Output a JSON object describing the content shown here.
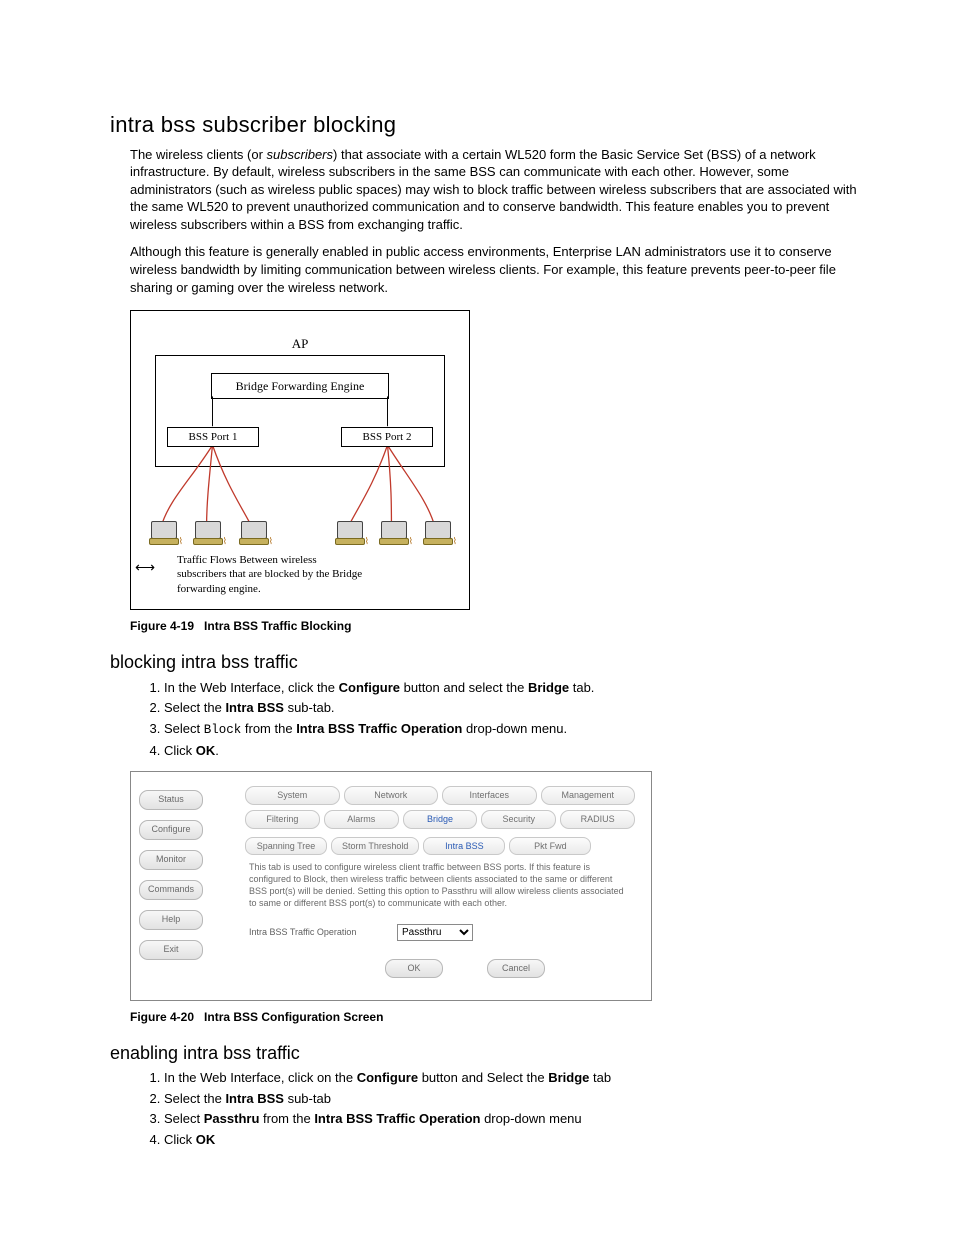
{
  "h1": "intra bss subscriber blocking",
  "p1_pre": "The wireless clients (or ",
  "p1_em": "subscribers",
  "p1_post": ") that associate with a certain WL520 form the Basic Service Set (BSS) of a network infrastructure. By default, wireless subscribers in the same BSS can communicate with each other. However, some administrators (such as wireless public spaces) may wish to block traffic between wireless subscribers that are associated with the same WL520 to prevent unauthorized communication and to conserve bandwidth. This feature enables you to prevent wireless subscribers within a BSS from exchanging traffic.",
  "p2": "Although this feature is generally enabled in public access environments, Enterprise LAN administrators use it to conserve wireless bandwidth by limiting communication between wireless clients. For example, this feature prevents peer-to-peer file sharing or gaming over the wireless network.",
  "fig19": {
    "ap": "AP",
    "bfe": "Bridge Forwarding Engine",
    "bss1": "BSS Port 1",
    "bss2": "BSS Port 2",
    "caption_text": "Traffic Flows Between wireless subscribers that are blocked by the Bridge forwarding engine.",
    "label_prefix": "Figure 4-19",
    "label_title": "Intra BSS Traffic Blocking"
  },
  "h2a": "blocking intra bss traffic",
  "steps_a": {
    "s1a": "In the Web Interface, click the ",
    "s1b": "Configure",
    "s1c": " button and select the ",
    "s1d": "Bridge",
    "s1e": " tab.",
    "s2a": "Select the ",
    "s2b": "Intra BSS",
    "s2c": " sub-tab.",
    "s3a": "Select ",
    "s3mono": "Block",
    "s3b": " from the ",
    "s3c": "Intra BSS Traffic Operation",
    "s3d": " drop-down menu.",
    "s4a": "Click ",
    "s4b": "OK",
    "s4c": "."
  },
  "fig20": {
    "side": [
      "Status",
      "Configure",
      "Monitor",
      "Commands",
      "Help",
      "Exit"
    ],
    "tabs1": [
      "System",
      "Network",
      "Interfaces",
      "Management"
    ],
    "tabs2": [
      "Filtering",
      "Alarms",
      "Bridge",
      "Security",
      "RADIUS"
    ],
    "tabs3": [
      "Spanning Tree",
      "Storm Threshold",
      "Intra BSS",
      "Pkt Fwd"
    ],
    "desc": "This tab is used to configure wireless client traffic between BSS ports. If this feature is configured to Block, then wireless traffic between clients associated to the same or different BSS port(s) will be denied. Setting this option to Passthru will allow wireless clients associated to same or different BSS port(s) to communicate with each other.",
    "field_label": "Intra BSS Traffic Operation",
    "field_value": "Passthru",
    "ok": "OK",
    "cancel": "Cancel",
    "label_prefix": "Figure 4-20",
    "label_title": "Intra BSS Configuration Screen"
  },
  "h2b": "enabling intra bss traffic",
  "steps_b": {
    "s1a": "In the Web Interface, click on the ",
    "s1b": "Configure",
    "s1c": " button and Select the ",
    "s1d": "Bridge",
    "s1e": " tab",
    "s2a": "Select the ",
    "s2b": "Intra BSS",
    "s2c": " sub-tab",
    "s3a": "Select ",
    "s3b": "Passthru",
    "s3c": " from the ",
    "s3d": "Intra BSS Traffic Operation",
    "s3e": " drop-down menu",
    "s4a": "Click ",
    "s4b": "OK"
  }
}
